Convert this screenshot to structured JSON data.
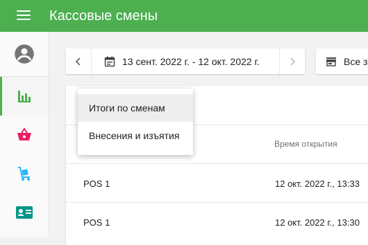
{
  "app": {
    "title": "Кассовые смены"
  },
  "toolbar": {
    "date_range": "13 сент. 2022 г. - 12 окт. 2022 г.",
    "store_selector": "Все за"
  },
  "report_menu": {
    "items": [
      {
        "label": "Итоги по сменам",
        "selected": true
      },
      {
        "label": "Внесения и изъятия",
        "selected": false
      }
    ]
  },
  "table": {
    "columns": [
      "",
      "Время открытия"
    ],
    "rows": [
      {
        "register": "POS 1",
        "opened": "12 окт. 2022 г., 13:33"
      },
      {
        "register": "POS 1",
        "opened": "12 окт. 2022 г., 13:30"
      }
    ]
  },
  "sidebar": {
    "items": [
      {
        "icon": "account-icon",
        "active": false
      },
      {
        "icon": "bar-chart-icon",
        "active": true,
        "color": "#4caf50"
      },
      {
        "icon": "shopping-basket-icon",
        "active": false,
        "color": "#e91e63"
      },
      {
        "icon": "hand-truck-icon",
        "active": false,
        "color": "#29b6f6"
      },
      {
        "icon": "contact-card-icon",
        "active": false,
        "color": "#009688"
      }
    ]
  },
  "colors": {
    "primary": "#4caf50",
    "basket": "#e91e63",
    "truck": "#29b6f6",
    "contact": "#009688"
  }
}
